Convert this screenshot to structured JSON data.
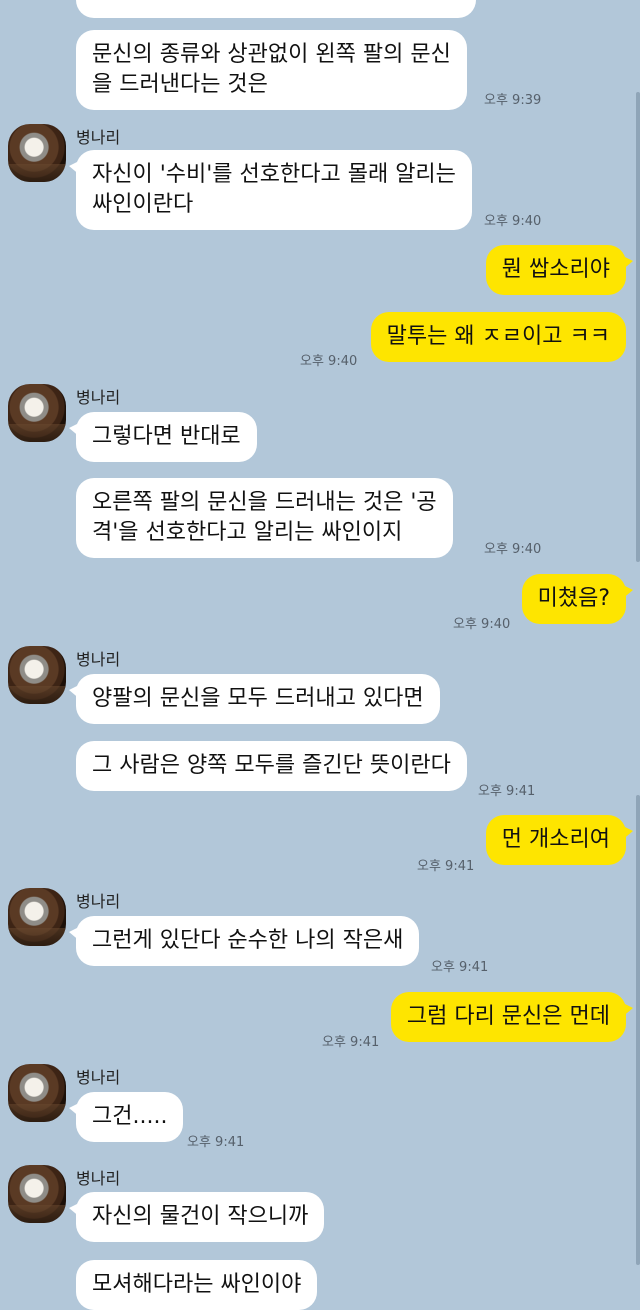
{
  "contact_name": "병나리",
  "messages": {
    "m0_partial": "",
    "m1_line1": "문신의 종류와 상관없이 왼쪽 팔의 문신",
    "m1_line2": "을 드러낸다는 것은",
    "t1": "오후 9:39",
    "m2_line1": "자신이 '수비'를 선호한다고 몰래 알리는",
    "m2_line2": "싸인이란다",
    "t2": "오후 9:40",
    "m3": "뭔 쌉소리야",
    "m4": "말투는 왜 ㅈㄹ이고 ㅋㅋ",
    "t4": "오후 9:40",
    "m5": "그렇다면 반대로",
    "m6_line1": "오른쪽 팔의 문신을 드러내는 것은 '공",
    "m6_line2": "격'을 선호한다고 알리는 싸인이지",
    "t6": "오후 9:40",
    "m7": "미쳤음?",
    "t7": "오후 9:40",
    "m8": "양팔의 문신을 모두 드러내고 있다면",
    "m9": "그 사람은 양쪽 모두를 즐긴단 뜻이란다",
    "t9": "오후 9:41",
    "m10": "먼 개소리여",
    "t10": "오후 9:41",
    "m11": "그런게 있단다 순수한 나의 작은새",
    "t11": "오후 9:41",
    "m12": "그럼 다리 문신은 먼데",
    "t12": "오후 9:41",
    "m13": "그건.....",
    "t13": "오후 9:41",
    "m14": "자신의 물건이 작으니까",
    "m15_partial": "모셔해다라는 싸인이야"
  },
  "colors": {
    "background": "#b2c7d9",
    "incoming_bubble": "#ffffff",
    "outgoing_bubble": "#fee500"
  },
  "icons": {
    "avatar": "profile-photo-icon"
  }
}
